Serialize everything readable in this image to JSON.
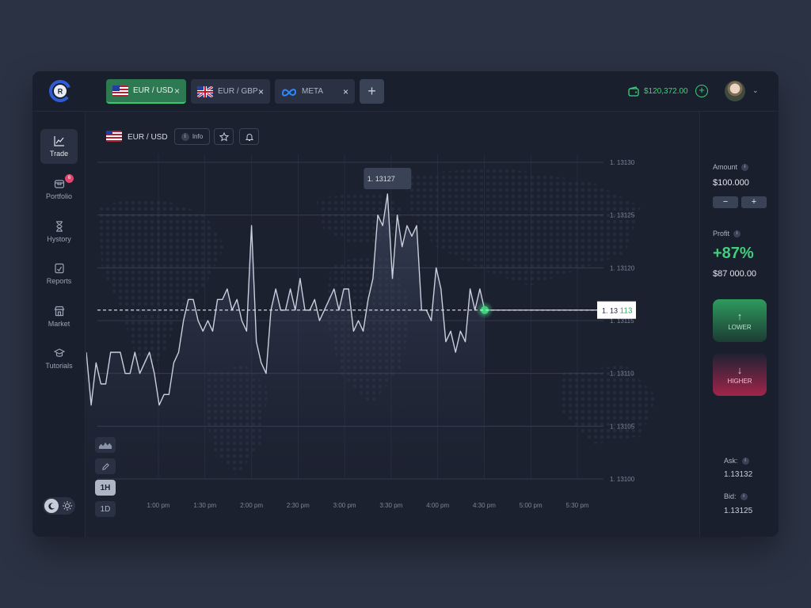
{
  "tabs": [
    {
      "label": "EUR / USD",
      "close": "×",
      "flag": "eu-us-flag"
    },
    {
      "label": "EUR / GBP",
      "close": "×",
      "flag": "eu-gb-flag"
    },
    {
      "label": "META",
      "close": "×",
      "flag": "meta-logo"
    }
  ],
  "add_tab": "+",
  "logo_letter": "R",
  "account": {
    "balance": "$120,372.00",
    "deposit": "+"
  },
  "nav": [
    {
      "label": "Trade",
      "icon": "chart-line-icon"
    },
    {
      "label": "Portfolio",
      "icon": "portfolio-icon",
      "badge": "6"
    },
    {
      "label": "Hystory",
      "icon": "hourglass-icon"
    },
    {
      "label": "Reports",
      "icon": "report-icon"
    },
    {
      "label": "Market",
      "icon": "store-icon"
    },
    {
      "label": "Tutorials",
      "icon": "graduation-cap-icon"
    }
  ],
  "chart_header": {
    "pair": "EUR / USD",
    "info": "Info",
    "info_icon": "i"
  },
  "tools": [
    "area-chart-icon",
    "pencil-icon",
    "1H",
    "1D"
  ],
  "chart_data": {
    "type": "line",
    "x_ticks": [
      "1:00 pm",
      "1:30 pm",
      "2:00 pm",
      "2:30 pm",
      "3:00 pm",
      "3:30 pm",
      "4:00  pm",
      "4:30 pm",
      "5:00  pm",
      "5:30 pm"
    ],
    "y_ticks": [
      "1. 13130",
      "1. 13125",
      "1. 13120",
      "1. 13115",
      "1. 13110",
      "1. 13105",
      "1. 13100"
    ],
    "y_values": [
      1.1313,
      1.13125,
      1.1312,
      1.13115,
      1.1311,
      1.13105,
      1.131
    ],
    "ylim": [
      1.131,
      1.1313
    ],
    "peak_label": "1. 13127",
    "current_price_prefix": "1. 13 ",
    "current_price_suffix": "113",
    "current_price": 1.13116,
    "series": [
      {
        "values": [
          1.13112,
          1.13107,
          1.13111,
          1.13109,
          1.13109,
          1.13112,
          1.13112,
          1.13112,
          1.1311,
          1.1311,
          1.13112,
          1.1311,
          1.13111,
          1.13112,
          1.1311,
          1.13107,
          1.13108,
          1.13108,
          1.13111,
          1.13112,
          1.13115,
          1.13117,
          1.13117,
          1.13115,
          1.13114,
          1.13115,
          1.13114,
          1.13117,
          1.13117,
          1.13118,
          1.13116,
          1.13117,
          1.13115,
          1.13114,
          1.13124,
          1.13113,
          1.13111,
          1.1311,
          1.13116,
          1.13118,
          1.13116,
          1.13116,
          1.13118,
          1.13116,
          1.13119,
          1.13116,
          1.13116,
          1.13117,
          1.13115,
          1.13116,
          1.13117,
          1.13118,
          1.13116,
          1.13118,
          1.13118,
          1.13114,
          1.13115,
          1.13114,
          1.13117,
          1.13119,
          1.13125,
          1.13124,
          1.13127,
          1.13119,
          1.13125,
          1.13122,
          1.13124,
          1.13123,
          1.13124,
          1.13116,
          1.13116,
          1.13115,
          1.1312,
          1.13118,
          1.13113,
          1.13114,
          1.13112,
          1.13114,
          1.13113,
          1.13118,
          1.13116,
          1.13118,
          1.13116
        ]
      }
    ]
  },
  "right_panel": {
    "amount_label": "Amount",
    "amount_value": "$100.000",
    "minus": "−",
    "plus": "+",
    "profit_label": "Profit",
    "profit_pct": "+87%",
    "profit_amount": "$87 000.00",
    "lower_label": "LOWER",
    "lower_arrow": "↑",
    "higher_label": "HIGHER",
    "higher_arrow": "↓",
    "ask_label": "Ask:",
    "ask_value": "1.13132",
    "bid_label": "Bid:",
    "bid_value": "1.13125",
    "info_icon": "i"
  },
  "colors": {
    "accent_green": "#3fd07c",
    "accent_red": "#a1254a",
    "panel": "#1a1f2d",
    "background": "#2b3243"
  }
}
